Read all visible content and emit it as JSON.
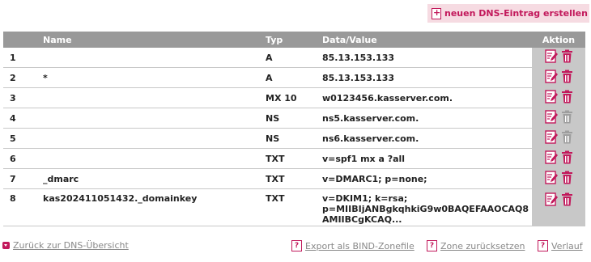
{
  "toolbar": {
    "new_entry_label": "neuen DNS-Eintrag erstellen"
  },
  "table": {
    "headers": {
      "num": "",
      "name": "Name",
      "typ": "Typ",
      "data": "Data/Value",
      "aktion": "Aktion"
    },
    "rows": [
      {
        "num": "1",
        "name": "",
        "typ": "A",
        "data": "85.13.153.133",
        "deletable": true
      },
      {
        "num": "2",
        "name": "*",
        "typ": "A",
        "data": "85.13.153.133",
        "deletable": true
      },
      {
        "num": "3",
        "name": "",
        "typ": "MX 10",
        "data": "w0123456.kasserver.com.",
        "deletable": true
      },
      {
        "num": "4",
        "name": "",
        "typ": "NS",
        "data": "ns5.kasserver.com.",
        "deletable": false
      },
      {
        "num": "5",
        "name": "",
        "typ": "NS",
        "data": "ns6.kasserver.com.",
        "deletable": false
      },
      {
        "num": "6",
        "name": "",
        "typ": "TXT",
        "data": "v=spf1 mx a ?all",
        "deletable": true
      },
      {
        "num": "7",
        "name": "_dmarc",
        "typ": "TXT",
        "data": "v=DMARC1; p=none;",
        "deletable": true
      },
      {
        "num": "8",
        "name": "kas202411051432._domainkey",
        "typ": "TXT",
        "data": "v=DKIM1; k=rsa;",
        "data2": "p=MIIBIjANBgkqhkiG9w0BAQEFAAOCAQ8",
        "data3": "AMIIBCgKCAQ...",
        "deletable": true
      }
    ]
  },
  "footer": {
    "back_label": "Zurück zur DNS-Übersicht",
    "export_label": "Export als BIND-Zonefile",
    "reset_label": "Zone zurücksetzen",
    "history_label": "Verlauf"
  },
  "colors": {
    "accent": "#c2185b",
    "header_bg": "#999999",
    "action_bg": "#c8c8c8",
    "button_bg": "#f6dbe2",
    "disabled_icon": "#9e9e9e"
  },
  "icons": {
    "new": "document-plus-icon",
    "edit": "edit-icon",
    "delete": "trash-icon",
    "help": "help-doc-icon"
  }
}
